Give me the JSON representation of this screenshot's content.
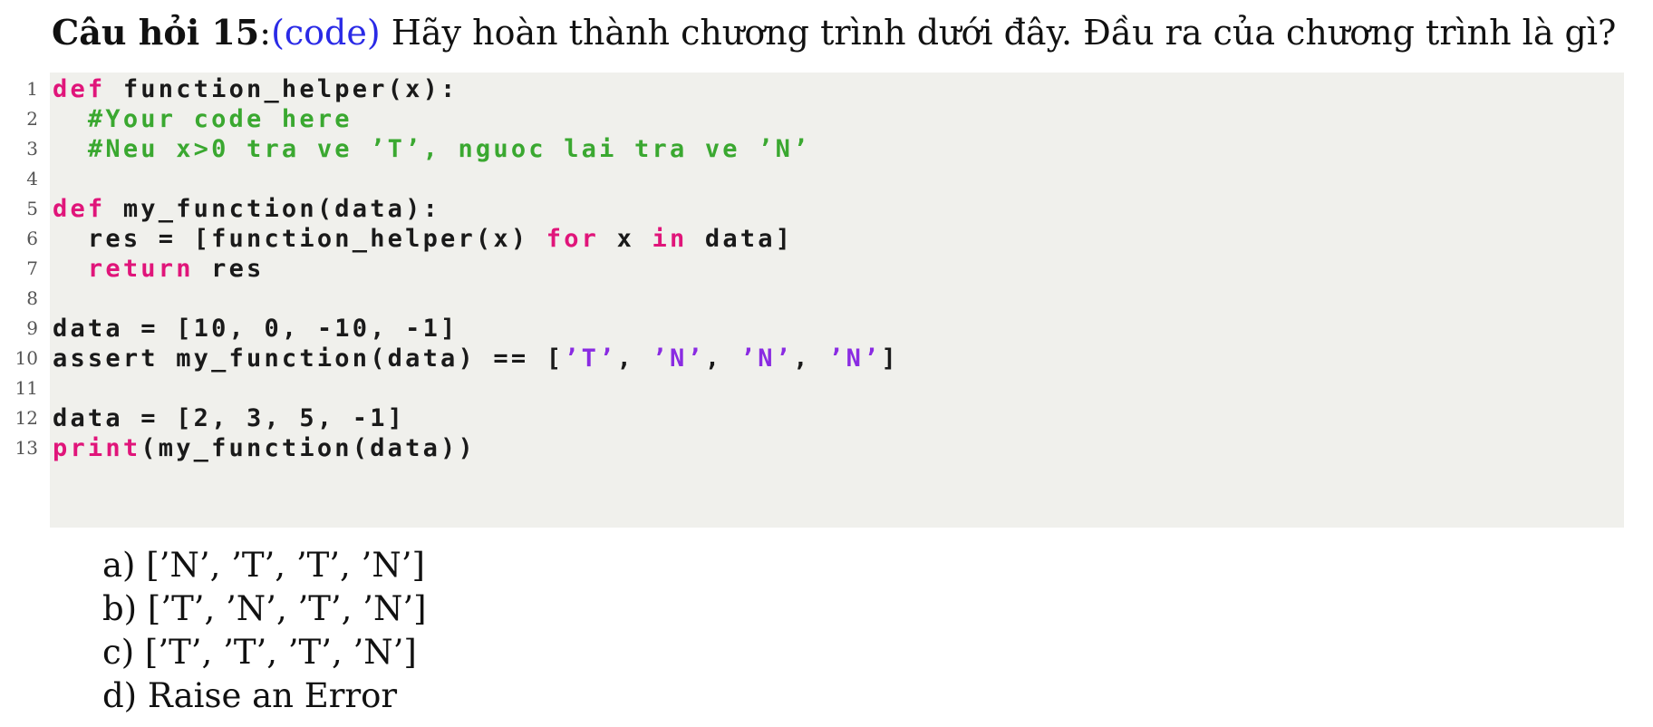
{
  "question": {
    "label": "Câu hỏi 15",
    "colon": ":",
    "tag": "(code)",
    "text": " Hãy hoàn thành chương trình dưới đây. Đầu ra của chương trình là gì?"
  },
  "code_lines": [
    {
      "n": "1",
      "parts": [
        {
          "t": "def",
          "c": "kw"
        },
        {
          "t": " function_helper(x):",
          "c": ""
        }
      ]
    },
    {
      "n": "2",
      "parts": [
        {
          "t": "  #Your code here",
          "c": "cm"
        }
      ]
    },
    {
      "n": "3",
      "parts": [
        {
          "t": "  #Neu x>0 tra ve ’T’, nguoc lai tra ve ’N’",
          "c": "cm"
        }
      ]
    },
    {
      "n": "4",
      "parts": []
    },
    {
      "n": "5",
      "parts": [
        {
          "t": "def",
          "c": "kw"
        },
        {
          "t": " my_function(data):",
          "c": ""
        }
      ]
    },
    {
      "n": "6",
      "parts": [
        {
          "t": "  res = [function_helper(x) ",
          "c": ""
        },
        {
          "t": "for",
          "c": "kw"
        },
        {
          "t": " x ",
          "c": ""
        },
        {
          "t": "in",
          "c": "kw"
        },
        {
          "t": " data]",
          "c": ""
        }
      ]
    },
    {
      "n": "7",
      "parts": [
        {
          "t": "  ",
          "c": ""
        },
        {
          "t": "return",
          "c": "kw"
        },
        {
          "t": " res",
          "c": ""
        }
      ]
    },
    {
      "n": "8",
      "parts": []
    },
    {
      "n": "9",
      "parts": [
        {
          "t": "data = [10, 0, -10, -1]",
          "c": ""
        }
      ]
    },
    {
      "n": "10",
      "parts": [
        {
          "t": "assert my_function(data) == [",
          "c": ""
        },
        {
          "t": "’T’",
          "c": "st"
        },
        {
          "t": ", ",
          "c": ""
        },
        {
          "t": "’N’",
          "c": "st"
        },
        {
          "t": ", ",
          "c": ""
        },
        {
          "t": "’N’",
          "c": "st"
        },
        {
          "t": ", ",
          "c": ""
        },
        {
          "t": "’N’",
          "c": "st"
        },
        {
          "t": "]",
          "c": ""
        }
      ]
    },
    {
      "n": "11",
      "parts": []
    },
    {
      "n": "12",
      "parts": [
        {
          "t": "data = [2, 3, 5, -1]",
          "c": ""
        }
      ]
    },
    {
      "n": "13",
      "parts": [
        {
          "t": "print",
          "c": "kw"
        },
        {
          "t": "(my_function(data))",
          "c": ""
        }
      ]
    }
  ],
  "answers": [
    "a) [’N’, ’T’, ’T’, ’N’]",
    "b) [’T’, ’N’, ’T’, ’N’]",
    "c) [’T’, ’T’, ’T’, ’N’]",
    "d) Raise an Error"
  ],
  "colors": {
    "keyword": "#e0157a",
    "comment": "#3aa830",
    "string": "#8a2be2",
    "code_background": "#f0f0ec",
    "tag": "#2a2ae6"
  }
}
